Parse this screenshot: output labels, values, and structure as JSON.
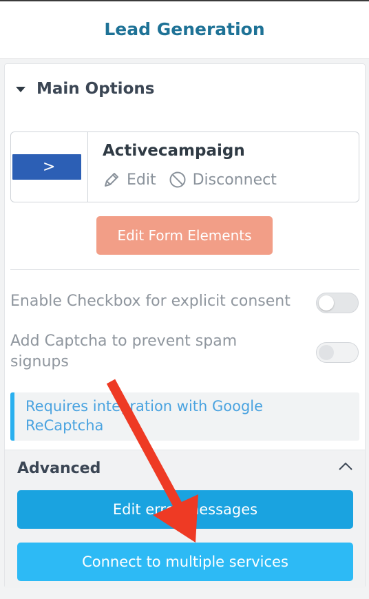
{
  "header": {
    "title": "Lead Generation"
  },
  "main_options": {
    "title": "Main Options",
    "service": {
      "name": "Activecampaign",
      "logo_glyph": ">",
      "logo_color": "#2c5fb5",
      "edit_label": "Edit",
      "disconnect_label": "Disconnect"
    },
    "edit_form_button": "Edit Form Elements",
    "consent_label": "Enable Checkbox for explicit consent",
    "consent_enabled": false,
    "captcha_label_line1": "Add Captcha to prevent spam",
    "captcha_label_line2": "signups",
    "captcha_enabled": false,
    "captcha_info_line1": "Requires integration with Google",
    "captcha_info_line2": "ReCaptcha"
  },
  "advanced": {
    "title": "Advanced",
    "edit_errors_button": "Edit error messages",
    "connect_button": "Connect to multiple services"
  },
  "colors": {
    "accent": "#1e7296",
    "primary_button": "#1aa3e0",
    "secondary_button": "#2dbaf5",
    "salmon_button": "#f29e87",
    "annotation_arrow": "#ee3a24"
  }
}
